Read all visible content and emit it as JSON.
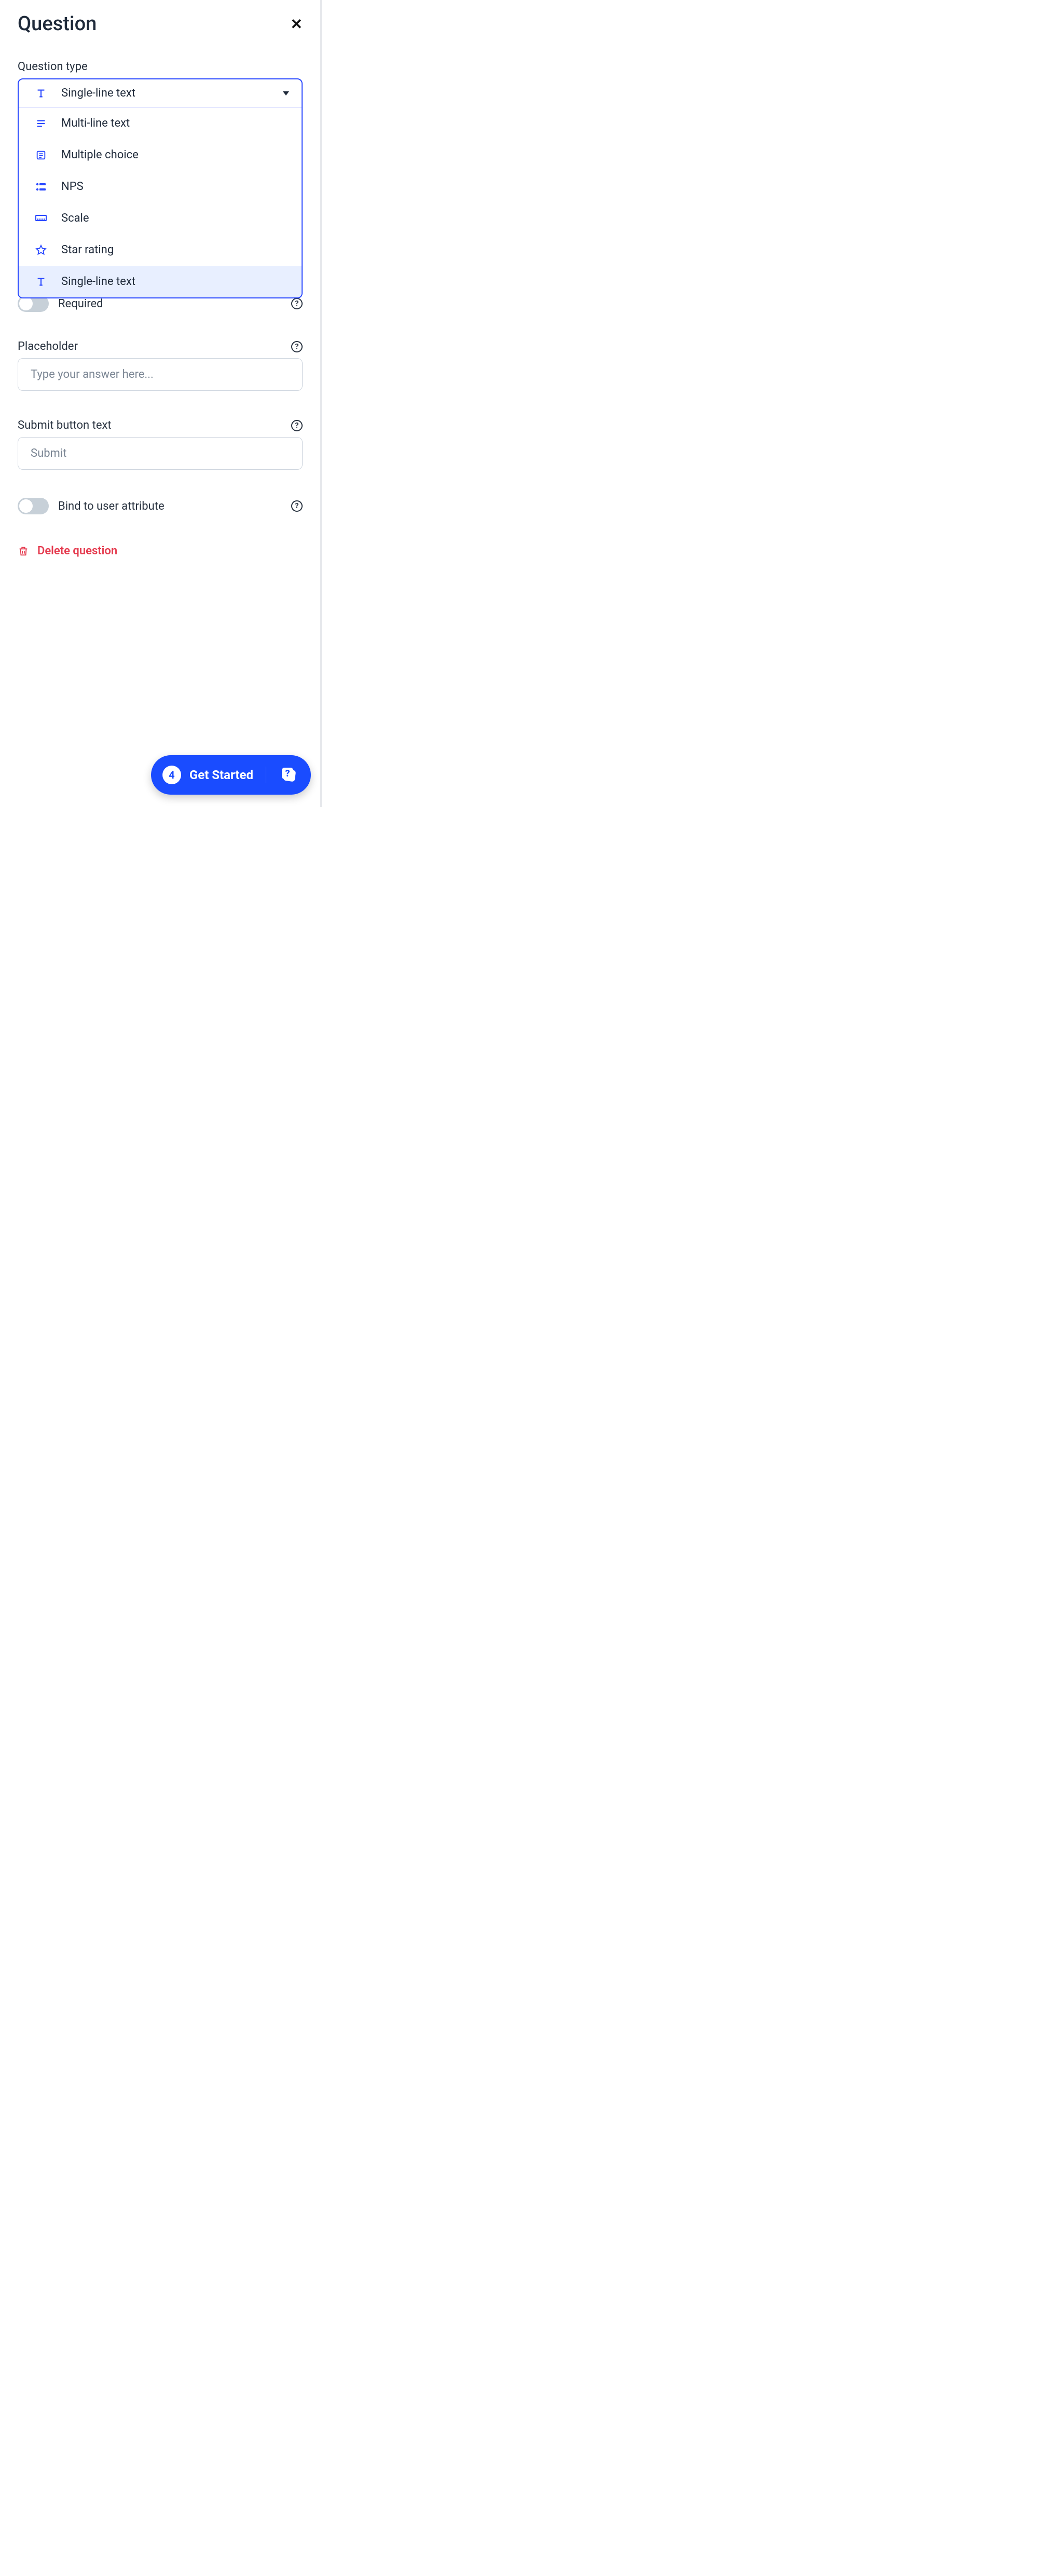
{
  "header": {
    "title": "Question"
  },
  "questionType": {
    "label": "Question type",
    "selected": "Single-line text",
    "options": [
      {
        "id": "multi-line",
        "label": "Multi-line text"
      },
      {
        "id": "multiple-choice",
        "label": "Multiple choice"
      },
      {
        "id": "nps",
        "label": "NPS"
      },
      {
        "id": "scale",
        "label": "Scale"
      },
      {
        "id": "star-rating",
        "label": "Star rating"
      },
      {
        "id": "single-line",
        "label": "Single-line text"
      }
    ]
  },
  "required": {
    "label": "Required",
    "enabled": false
  },
  "placeholder": {
    "label": "Placeholder",
    "value": "Type your answer here..."
  },
  "submitButton": {
    "label": "Submit button text",
    "value": "Submit"
  },
  "bindAttribute": {
    "label": "Bind to user attribute",
    "enabled": false
  },
  "deleteQuestion": {
    "label": "Delete question"
  },
  "floating": {
    "badge": "4",
    "label": "Get Started"
  }
}
